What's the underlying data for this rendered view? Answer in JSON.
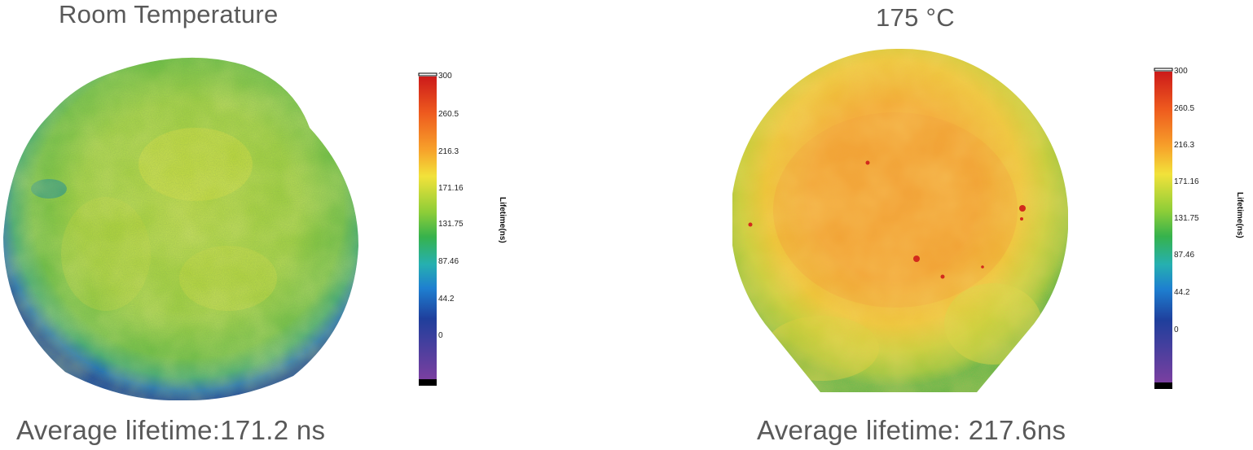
{
  "panels": [
    {
      "title": "Room Temperature",
      "caption": "Average lifetime:171.2 ns",
      "dominant_colors": [
        "#9fd63a",
        "#cfe13a",
        "#4ab84e",
        "#1b5cb0"
      ]
    },
    {
      "title": "175 °C",
      "caption": "Average lifetime: 217.6ns",
      "dominant_colors": [
        "#f3a832",
        "#e8c532",
        "#9ccd38",
        "#d9271c"
      ]
    }
  ],
  "colorbar": {
    "label": "Lifetime(ns)",
    "ticks": [
      "300",
      "260.5",
      "216.3",
      "171.16",
      "131.75",
      "87.46",
      "44.2",
      "0"
    ],
    "gradient": [
      "#cc1a1a",
      "#ee5a1e",
      "#f7a02a",
      "#f2e23a",
      "#8ccd38",
      "#36b24c",
      "#26b0b0",
      "#1e7fd0",
      "#1f3f9c",
      "#7a3fa0"
    ]
  }
}
